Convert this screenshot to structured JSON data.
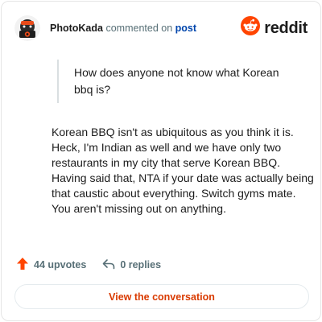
{
  "header": {
    "username": "PhotoKada",
    "action_text": "commented on",
    "post_link": "post",
    "avatar_icon": "photographer-avatar-icon",
    "brand_icon": "reddit-snoo-icon",
    "brand_name": "reddit"
  },
  "quote": {
    "text": "How does anyone not know what Korean bbq is?"
  },
  "comment": {
    "body": "Korean BBQ isn't as ubiquitous as you think it is. Heck, I'm Indian as well and we have only two restaurants in my city that serve Korean BBQ. Having said that, NTA if your date was actually being that caustic about everything. Switch gyms mate. You aren't missing out on anything."
  },
  "actions": {
    "upvotes_label": "44 upvotes",
    "replies_label": "0 replies",
    "upvote_icon": "upvote-arrow-icon",
    "reply_icon": "reply-arrow-icon"
  },
  "cta": {
    "label": "View the conversation"
  },
  "colors": {
    "reddit_orange": "#ff4500",
    "cta_text": "#d93a00",
    "link_blue": "#0045ac",
    "meta_gray": "#576f76"
  }
}
